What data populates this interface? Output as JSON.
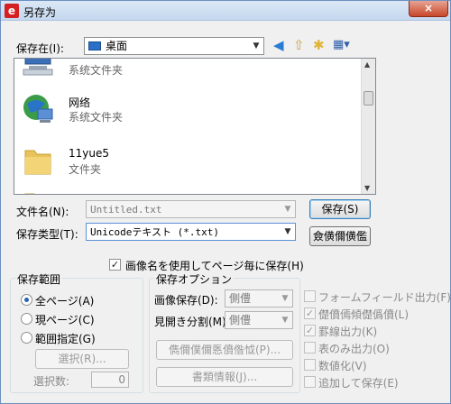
{
  "window": {
    "title": "另存为",
    "app_icon": "e",
    "close": "×"
  },
  "toolbar": {
    "save_in_label": "保存在(I):",
    "save_in_value": "桌面",
    "icons": [
      "back-icon",
      "up-folder-icon",
      "new-folder-icon",
      "view-menu-icon"
    ]
  },
  "files": [
    {
      "name": "",
      "type": "系统文件夹",
      "icon": "computer-icon"
    },
    {
      "name": "网络",
      "type": "系统文件夹",
      "icon": "network-icon"
    },
    {
      "name": "11yue5",
      "type": "文件夹",
      "icon": "folder-icon"
    }
  ],
  "form": {
    "filename_label": "文件名(N):",
    "filename_value": "Untitled.txt",
    "filetype_label": "保存类型(T):",
    "filetype_value": "Unicodeテキスト (*.txt)",
    "save_button": "保存(S)",
    "cancel_button": "僉僙儞僙儖"
  },
  "options": {
    "image_name_check": "画像名を使用してページ毎に保存(H)",
    "range_title": "保存範囲",
    "range_all": "全ページ(A)",
    "range_current": "現ページ(C)",
    "range_specified": "範囲指定(G)",
    "select_button": "選択(R)...",
    "select_count_label": "選択数:",
    "select_count_value": "0",
    "save_options_title": "保存オプション",
    "image_save_label": "画像保存(D):",
    "image_save_value": "側僼",
    "page_split_label": "見開き分割(M):",
    "page_split_value": "側僼",
    "image_settings_button": "儁儞僕儞悘僨偺怴(P)...",
    "doc_info_button": "書類情報(J)...",
    "form_field_output": "フォームフィールド出力(F)",
    "orig_info": "儊僨傿傾儊僞僨(L)",
    "ruled_output": "罫線出力(K)",
    "table_only_output": "表のみ出力(O)",
    "numeric": "数値化(V)",
    "append_save": "追加して保存(E)"
  }
}
